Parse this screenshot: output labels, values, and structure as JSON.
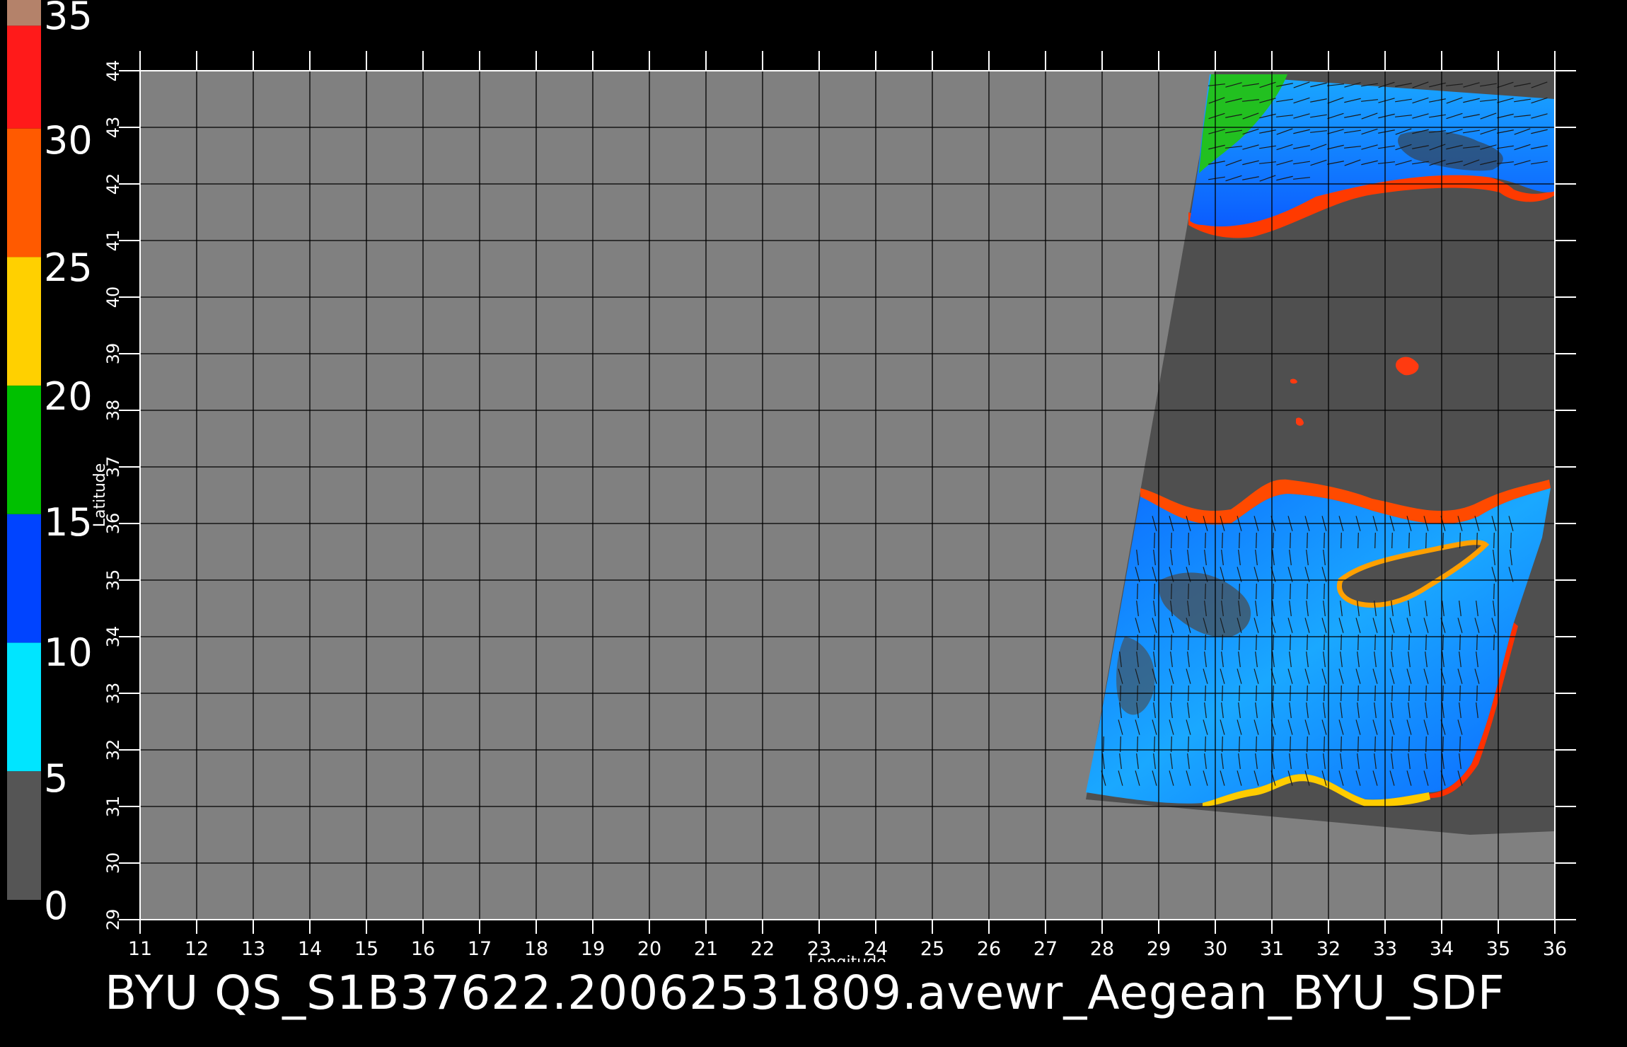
{
  "footer": {
    "title": "BYU  QS_S1B37622.20062531809.avewr_Aegean_BYU_SDF"
  },
  "colorbar": {
    "labels": [
      "35",
      "30",
      "25",
      "20",
      "15",
      "10",
      "5",
      "0"
    ],
    "segments": [
      {
        "from": 35,
        "to": 34,
        "color": "#b4826a"
      },
      {
        "from": 34,
        "to": 30,
        "color": "#ff1a1a"
      },
      {
        "from": 30,
        "to": 25,
        "color": "#ff5a00"
      },
      {
        "from": 25,
        "to": 20,
        "color": "#ffd000"
      },
      {
        "from": 20,
        "to": 15,
        "color": "#00c000"
      },
      {
        "from": 15,
        "to": 10,
        "color": "#0044ff"
      },
      {
        "from": 10,
        "to": 5,
        "color": "#00e5ff"
      },
      {
        "from": 5,
        "to": 0,
        "color": "#555555"
      }
    ]
  },
  "map": {
    "xlabel": "Longitude",
    "ylabel": "Latitude",
    "lon_range": [
      11,
      36
    ],
    "lat_range": [
      29,
      44
    ],
    "lon_ticks": [
      "11",
      "12",
      "13",
      "14",
      "15",
      "16",
      "17",
      "18",
      "19",
      "20",
      "21",
      "22",
      "23",
      "24",
      "25",
      "26",
      "27",
      "28",
      "29",
      "30",
      "31",
      "32",
      "33",
      "34",
      "35",
      "36"
    ],
    "lat_ticks": [
      "29",
      "30",
      "31",
      "32",
      "33",
      "34",
      "35",
      "36",
      "37",
      "38",
      "39",
      "40",
      "41",
      "42",
      "43",
      "44"
    ],
    "colors": {
      "background": "#000000",
      "no_data": "#808080",
      "swath_land": "#4f4f4f",
      "ocean_low": "#1aa6ff",
      "ocean_mid": "#0b72ff",
      "gridline": "#000000",
      "text": "#ffffff"
    }
  }
}
